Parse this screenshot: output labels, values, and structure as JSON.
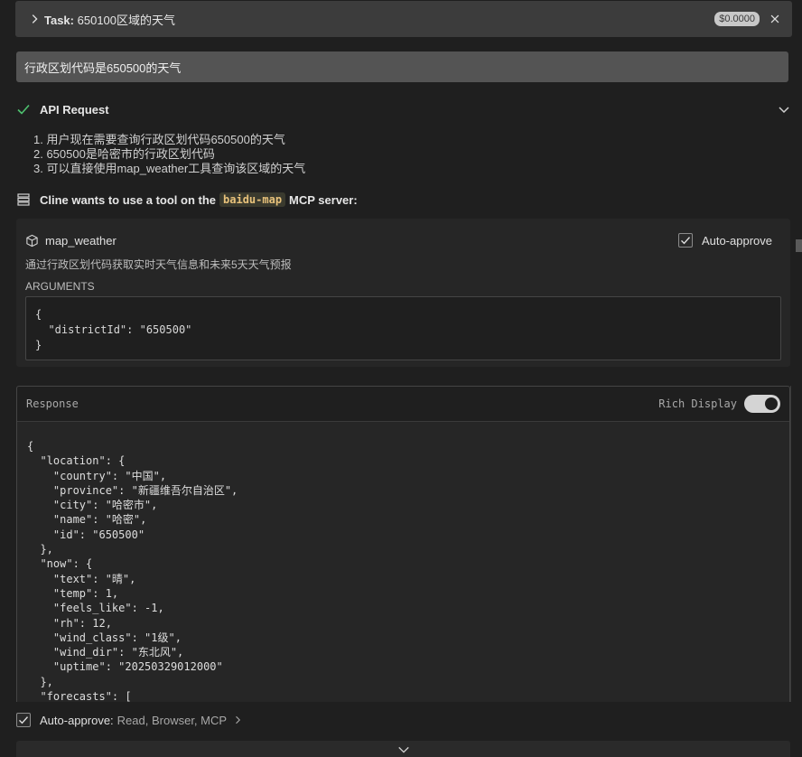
{
  "task": {
    "prefix": "Task:",
    "title": "650100区域的天气",
    "cost": "$0.0000",
    "chevron_icon": "chevron-right-icon",
    "close_icon": "close-icon"
  },
  "user_message": "行政区划代码是650500的天气",
  "api_request": {
    "label": "API Request",
    "status_icon": "check-icon",
    "status_color": "#4ec26f",
    "expand_icon": "chevron-down-icon",
    "thinking": [
      "1. 用户现在需要查询行政区划代码650500的天气",
      "2. 650500是哈密市的行政区划代码",
      "3. 可以直接使用map_weather工具查询该区域的天气"
    ]
  },
  "tool_use": {
    "prefix": "Cline wants to use a tool on the",
    "server_name": "baidu-map",
    "suffix": "MCP server:",
    "server_icon": "server-icon"
  },
  "tool": {
    "name": "map_weather",
    "icon": "cube-icon",
    "description": "通过行政区划代码获取实时天气信息和未来5天天气预报",
    "auto_approve_label": "Auto-approve",
    "auto_approve_checked": true,
    "arguments_label": "ARGUMENTS",
    "arguments_text": "{\n  \"districtId\": \"650500\"\n}"
  },
  "response": {
    "label": "Response",
    "rich_display_label": "Rich Display",
    "rich_display_on": true,
    "json_text": "{\n  \"location\": {\n    \"country\": \"中国\",\n    \"province\": \"新疆维吾尔自治区\",\n    \"city\": \"哈密市\",\n    \"name\": \"哈密\",\n    \"id\": \"650500\"\n  },\n  \"now\": {\n    \"text\": \"晴\",\n    \"temp\": 1,\n    \"feels_like\": -1,\n    \"rh\": 12,\n    \"wind_class\": \"1级\",\n    \"wind_dir\": \"东北风\",\n    \"uptime\": \"20250329012000\"\n  },\n  \"forecasts\": ["
  },
  "bottom": {
    "auto_approve_label": "Auto-approve:",
    "auto_approve_options": "Read, Browser, MCP",
    "checked": true
  }
}
